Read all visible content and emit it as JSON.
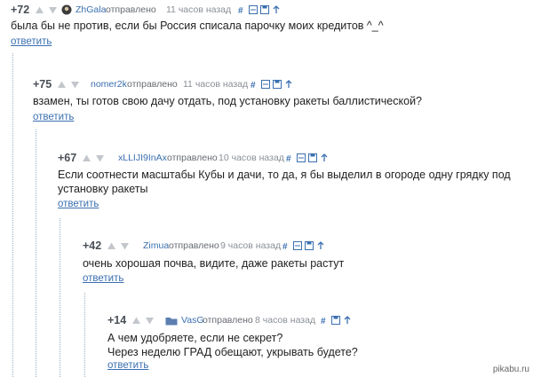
{
  "comments": [
    {
      "score": "+72",
      "user": "ZhGala",
      "sent": "отправлено",
      "time": "11 часов назад",
      "text": "была бы не против, если бы Россия списала парочку моих кредитов ^_^",
      "reply": "ответить",
      "avatar": "user-avatar-icon"
    },
    {
      "score": "+75",
      "user": "nomer2k",
      "sent": "отправлено",
      "time": "11 часов назад",
      "text": "взамен, ты готов свою дачу отдать, под установку ракеты баллистической?",
      "reply": "ответить",
      "avatar": ""
    },
    {
      "score": "+67",
      "user": "xLLIJI9InAx",
      "sent": "отправлено",
      "time": "10 часов назад",
      "text": "Если соотнести масштабы Кубы и дачи, то да, я бы выделил в огороде одну грядку под установку ракеты",
      "reply": "ответить",
      "avatar": ""
    },
    {
      "score": "+42",
      "user": "Zimua",
      "sent": "отправлено",
      "time": "9 часов назад",
      "text": "очень хорошая почва, видите, даже ракеты растут",
      "reply": "ответить",
      "avatar": ""
    },
    {
      "score": "+14",
      "user": "VasG",
      "sent": "отправлено",
      "time": "8 часов назад",
      "text": "А чем удобряете, если не секрет?\nЧерез неделю ГРАД обещают, укрывать будете?",
      "reply": "ответить",
      "avatar": "folder-avatar-icon"
    }
  ],
  "watermark": "pikabu.ru",
  "colors": {
    "link": "#3a6fb0",
    "text": "#222222",
    "meta": "#8a8f96",
    "thread_line": "#9ab0c4"
  }
}
